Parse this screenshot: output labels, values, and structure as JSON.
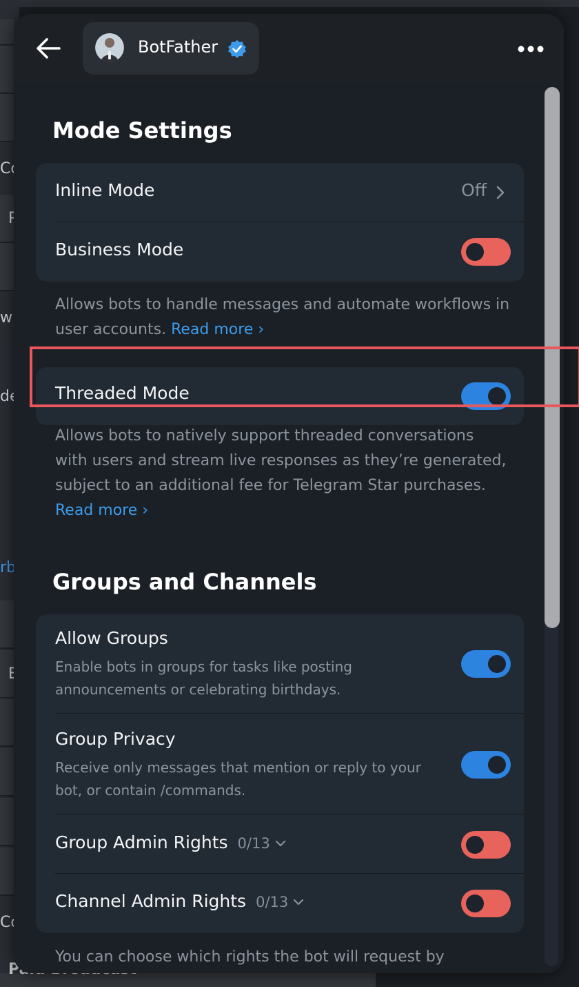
{
  "background": {
    "fragments": [
      "Co",
      "P",
      "wil",
      "de",
      "rb",
      "E",
      "Co"
    ],
    "bottom_label": "Paid Broadcast"
  },
  "header": {
    "bot_name": "BotFather"
  },
  "mode_settings": {
    "title": "Mode Settings",
    "inline_mode": {
      "label": "Inline Mode",
      "value": "Off"
    },
    "business_mode": {
      "label": "Business Mode",
      "enabled": false
    },
    "business_desc": "Allows bots to handle messages and automate workflows in user accounts.",
    "business_link": "Read more ›",
    "threaded_mode": {
      "label": "Threaded Mode",
      "enabled": true
    },
    "threaded_desc": "Allows bots to natively support threaded conversations with users and stream live responses as they’re generated, subject to an additional fee for Telegram Star purchases.",
    "threaded_link": "Read more ›"
  },
  "groups_channels": {
    "title": "Groups and Channels",
    "allow_groups": {
      "label": "Allow Groups",
      "sub": "Enable bots in groups for tasks like posting announcements or celebrating birthdays.",
      "enabled": true
    },
    "group_privacy": {
      "label": "Group Privacy",
      "sub": "Receive only messages that mention or reply to your bot, or contain /commands.",
      "enabled": true
    },
    "group_admin": {
      "label": "Group Admin Rights",
      "count": "0/13",
      "enabled": false
    },
    "channel_admin": {
      "label": "Channel Admin Rights",
      "count": "0/13",
      "enabled": false
    },
    "footer": "You can choose which rights the bot will request by"
  },
  "colors": {
    "accent": "#2c84e0",
    "toggle_off": "#e8635b",
    "link": "#3d9be9",
    "highlight": "#e9565c"
  }
}
